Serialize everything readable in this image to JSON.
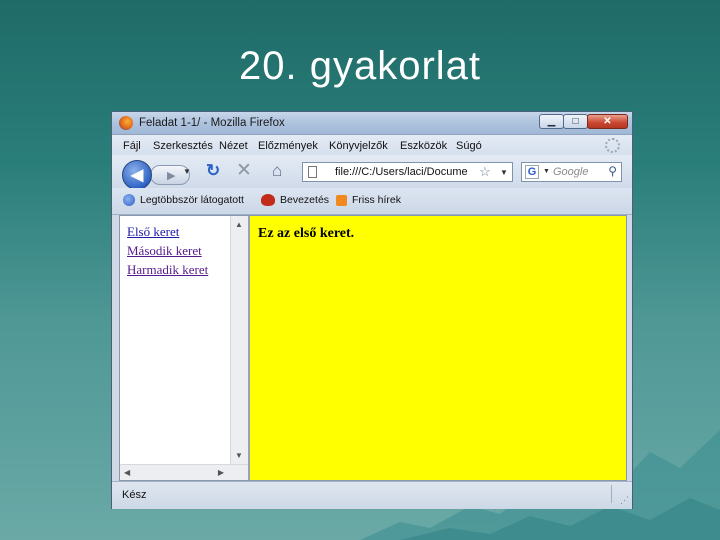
{
  "slide": {
    "title": "20. gyakorlat"
  },
  "window": {
    "title": "Feladat 1-1/ - Mozilla Firefox",
    "buttons": {
      "minimize": "▁",
      "maximize": "□",
      "close": "✕"
    }
  },
  "menu": {
    "items": [
      "Fájl",
      "Szerkesztés",
      "Nézet",
      "Előzmények",
      "Könyvjelzők",
      "Eszközök",
      "Súgó"
    ]
  },
  "navbar": {
    "url": "file:///C:/Users/laci/Docume",
    "search_engine": "G",
    "search_placeholder": "Google"
  },
  "bookmarks": {
    "items": [
      {
        "label": "Legtöbbször látogatott",
        "icon": "globe-icon"
      },
      {
        "label": "Bevezetés",
        "icon": "ladybug-icon"
      },
      {
        "label": "Friss hírek",
        "icon": "rss-icon"
      }
    ]
  },
  "left_frame": {
    "links": [
      "Első keret",
      "Második keret",
      "Harmadik keret"
    ]
  },
  "right_frame": {
    "heading": "Ez az első keret.",
    "background": "#ffff00"
  },
  "status": {
    "text": "Kész"
  }
}
